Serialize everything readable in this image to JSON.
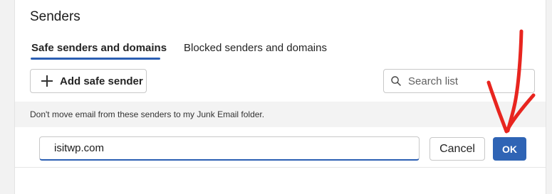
{
  "section": {
    "title": "Senders"
  },
  "tabs": [
    {
      "label": "Safe senders and domains",
      "active": true
    },
    {
      "label": "Blocked senders and domains",
      "active": false
    }
  ],
  "toolbar": {
    "add_label": "Add safe sender",
    "add_icon": "plus-icon",
    "search_placeholder": "Search list",
    "search_icon": "search-icon"
  },
  "info": {
    "text": "Don't move email from these senders to my Junk Email folder."
  },
  "editor": {
    "value": "isitwp.com",
    "cancel_label": "Cancel",
    "ok_label": "OK"
  },
  "colors": {
    "accent": "#2b5fb3",
    "ok_button": "#2f64b5",
    "annotation_arrow": "#e8251f"
  }
}
